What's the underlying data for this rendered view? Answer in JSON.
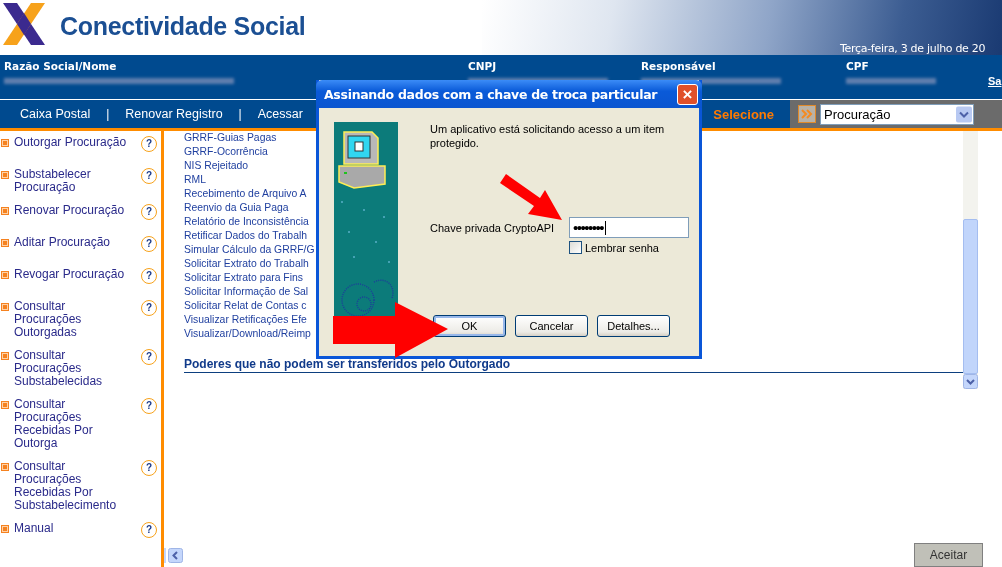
{
  "header": {
    "title": "Conectividade Social",
    "date": "Terça-feira, 3 de julho de 20",
    "logout": "Sa"
  },
  "info_fields": [
    {
      "label": "Razão Social/Nome"
    },
    {
      "label": "CNPJ"
    },
    {
      "label": "Responsável"
    },
    {
      "label": "CPF"
    }
  ],
  "nav": [
    {
      "kind": "link",
      "label": "Caixa Postal"
    },
    {
      "kind": "separator",
      "label": "|"
    },
    {
      "kind": "link",
      "label": "Renovar Registro"
    },
    {
      "kind": "separator",
      "label": "|"
    },
    {
      "kind": "link",
      "label": "Acessar"
    }
  ],
  "selector": {
    "label": "Selecione",
    "value": "Procuração"
  },
  "sidebar": {
    "items": [
      {
        "label": "Outorgar Procuração",
        "help": "?"
      },
      {
        "label": "Substabelecer Procuração",
        "help": "?"
      },
      {
        "label": "Renovar Procuração",
        "help": "?"
      },
      {
        "label": "Aditar Procuração",
        "help": "?"
      },
      {
        "label": "Revogar Procuração",
        "help": "?"
      },
      {
        "label": "Consultar Procurações Outorgadas",
        "help": "?"
      },
      {
        "label": "Consultar Procurações Substabelecidas",
        "help": "?"
      },
      {
        "label": "Consultar Procurações Recebidas Por Outorga",
        "help": "?"
      },
      {
        "label": "Consultar Procurações Recebidas Por Substabelecimento",
        "help": "?"
      },
      {
        "label": "Manual",
        "help": "?"
      }
    ]
  },
  "content": {
    "links": [
      "GRRF-Guias Pagas",
      "GRRF-Ocorrência",
      "NIS Rejeitado",
      "RML",
      "Recebimento de Arquivo A",
      "Reenvio da Guia Paga",
      "Relatório de Inconsistência",
      "Retificar Dados do Trabalh",
      "Simular Cálculo da GRRF/G",
      "Solicitar Extrato do Trabalh",
      "Solicitar Extrato para Fins",
      "Solicitar Informação de Sal",
      "Solicitar Relat de Contas c",
      "Visualizar Retificações Efe",
      "Visualizar/Download/Reimp"
    ],
    "section_heading": "Poderes que não podem ser transferidos pelo Outorgado"
  },
  "dialog": {
    "title": "Assinando dados com a chave de troca particular",
    "close": "×",
    "message": "Um aplicativo está solicitando acesso a um item protegido.",
    "field_label": "Chave privada CryptoAPI",
    "password": "••••••••",
    "remember": {
      "label": "Lembrar senha",
      "checked": false
    },
    "buttons": [
      {
        "label": "OK",
        "selected": true
      },
      {
        "label": "Cancelar",
        "selected": false
      },
      {
        "label": "Detalhes...",
        "selected": false
      }
    ]
  },
  "footer": {
    "button": "Aceitar"
  }
}
